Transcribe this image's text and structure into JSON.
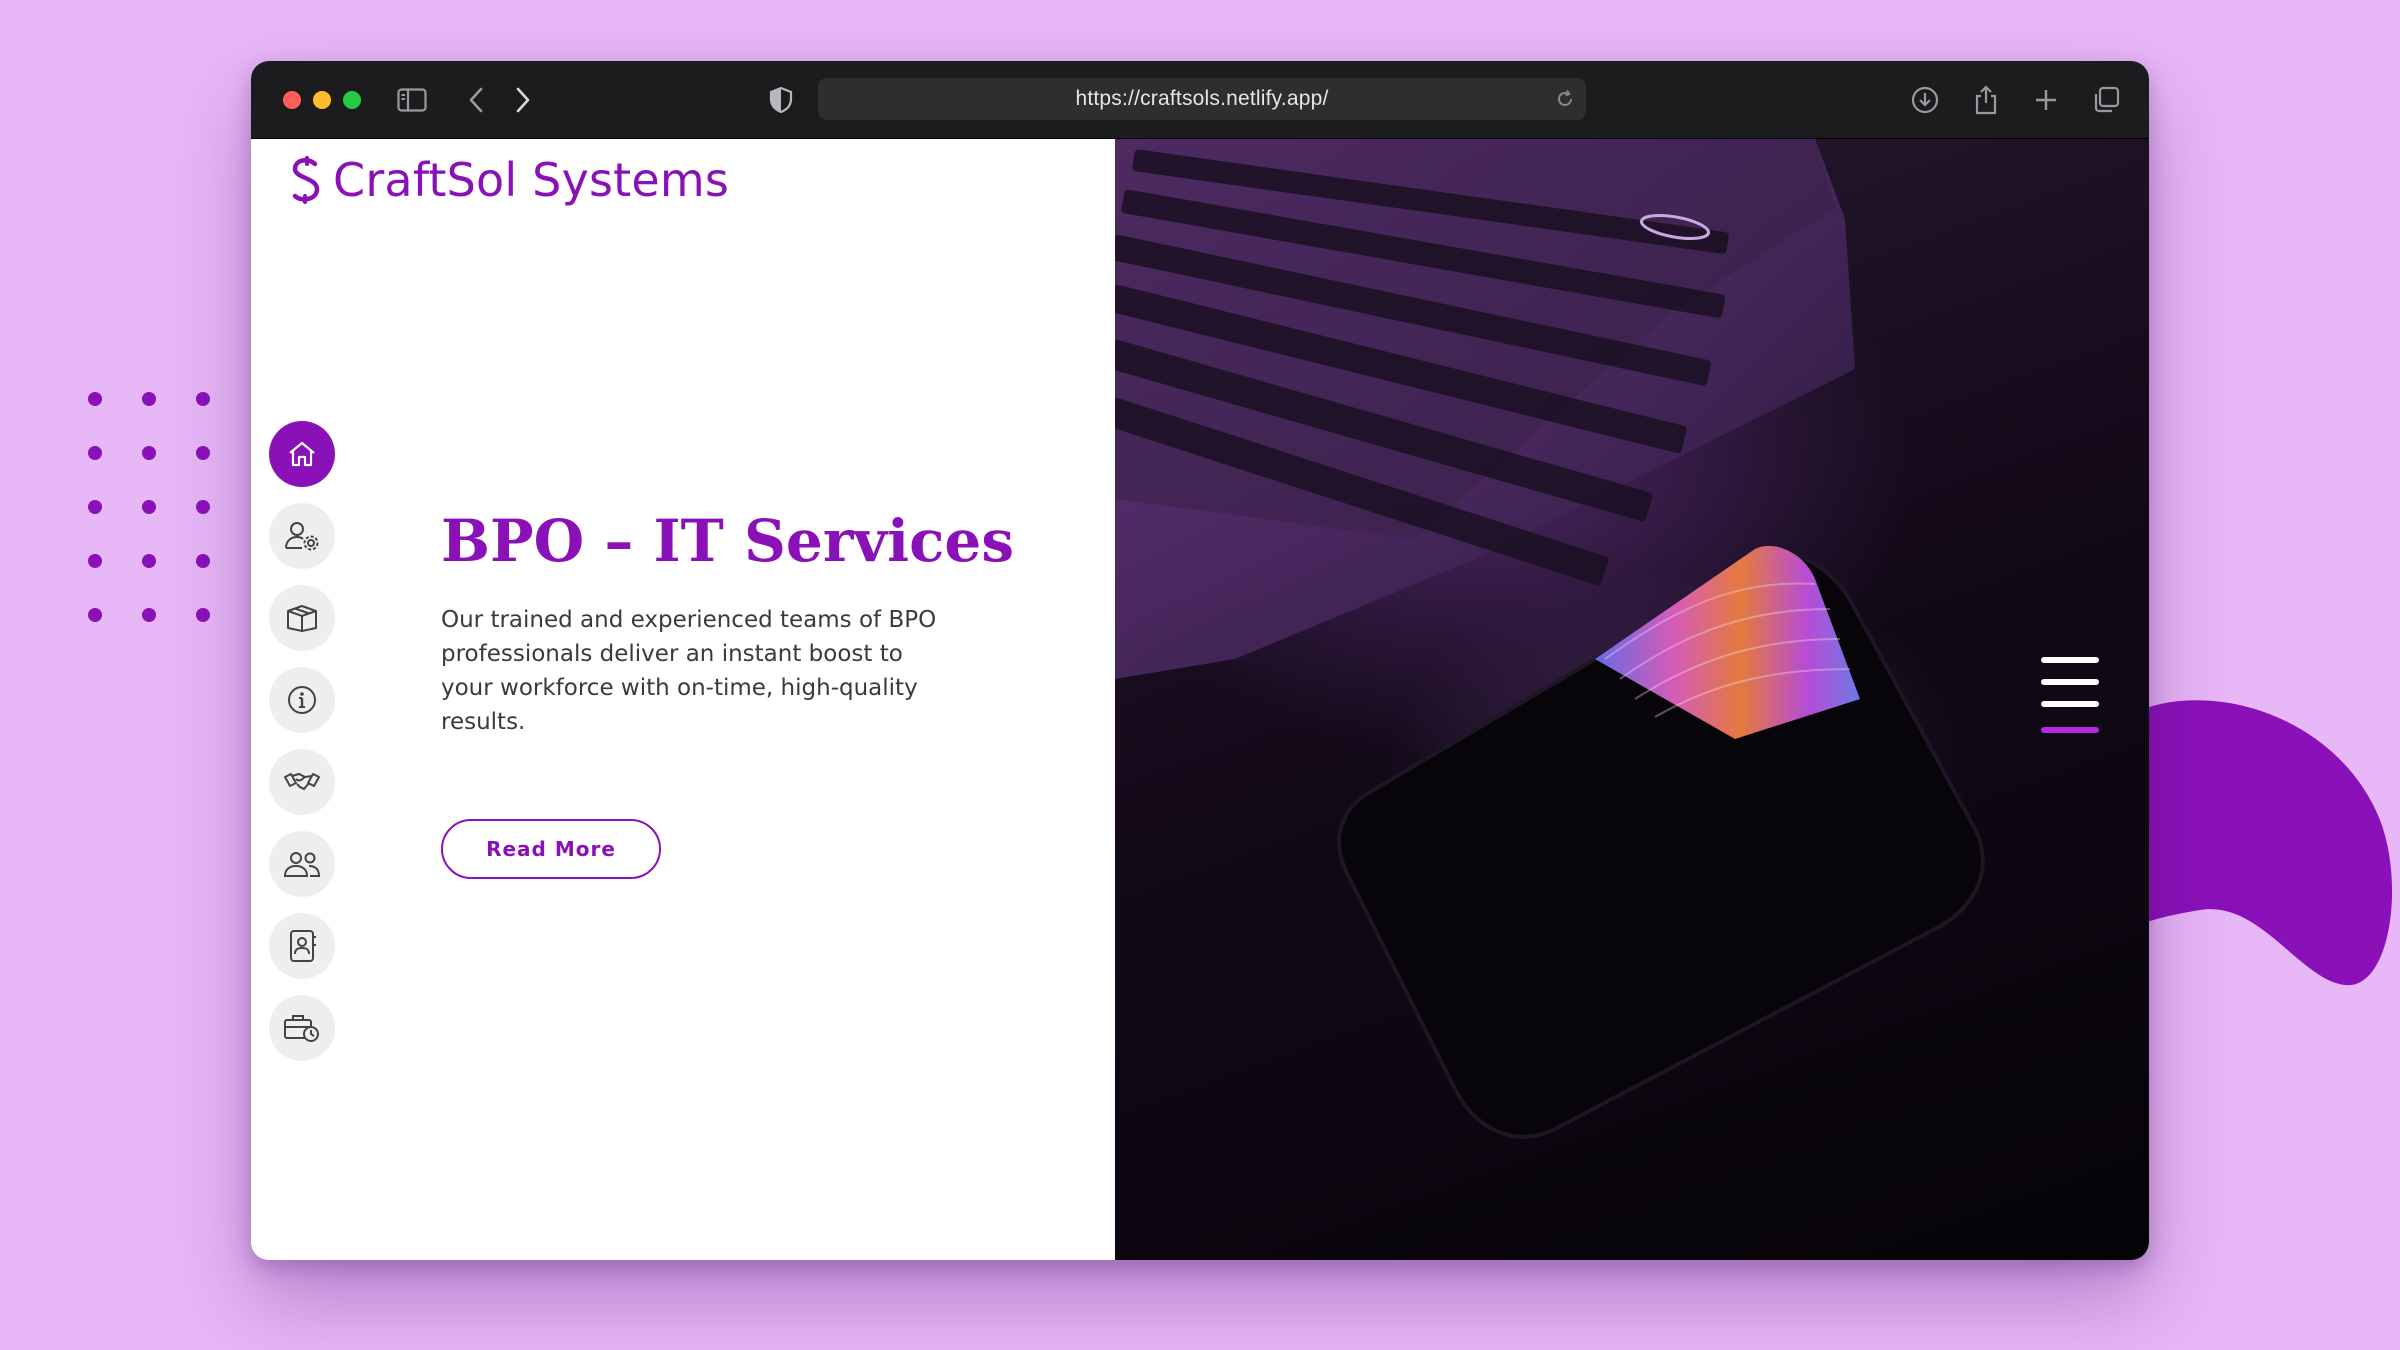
{
  "browser": {
    "url": "https://craftsols.netlify.app/",
    "icons": [
      "sidebar-icon",
      "back-icon",
      "forward-icon",
      "shield-icon",
      "reload-icon",
      "download-icon",
      "share-icon",
      "new-tab-icon",
      "tabs-overview-icon"
    ]
  },
  "site": {
    "logo_text": "CraftSol Systems",
    "brand_color": "#8a10b8"
  },
  "side_nav": {
    "items": [
      {
        "icon": "home-icon",
        "active": true
      },
      {
        "icon": "user-settings-icon",
        "active": false
      },
      {
        "icon": "box-icon",
        "active": false
      },
      {
        "icon": "info-icon",
        "active": false
      },
      {
        "icon": "handshake-icon",
        "active": false
      },
      {
        "icon": "team-icon",
        "active": false
      },
      {
        "icon": "contact-book-icon",
        "active": false
      },
      {
        "icon": "briefcase-clock-icon",
        "active": false
      }
    ]
  },
  "hero": {
    "title": "BPO – IT Services",
    "description": "Our trained and experienced teams of BPO professionals deliver an instant boost to your workforce with on-time, high-quality results.",
    "cta_label": "Read More"
  },
  "menu": {
    "icon": "hamburger-menu-icon"
  }
}
